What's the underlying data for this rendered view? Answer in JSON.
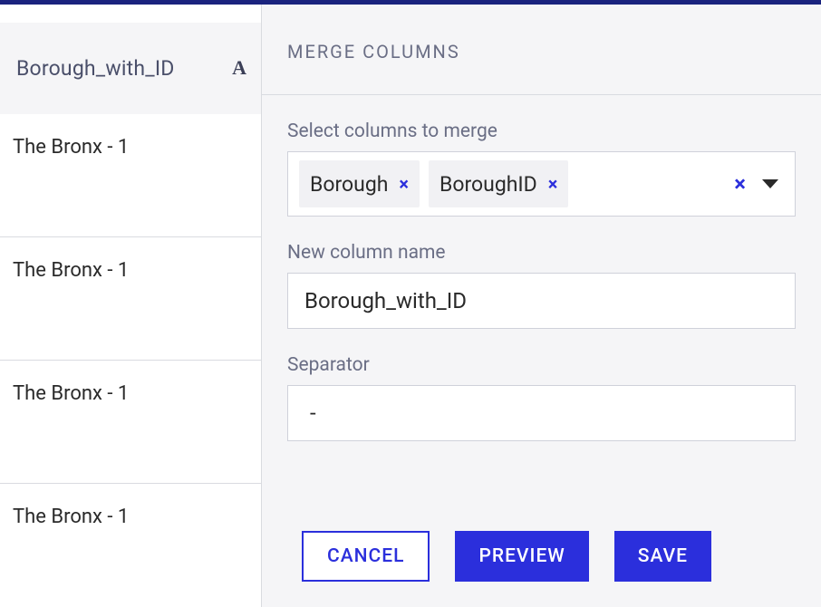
{
  "left_column": {
    "header_label": "Borough_with_ID",
    "rows": [
      "The Bronx - 1",
      "The Bronx - 1",
      "The Bronx - 1",
      "The Bronx - 1"
    ]
  },
  "panel": {
    "title": "MERGE COLUMNS",
    "select_columns_label": "Select columns to merge",
    "selected_columns": [
      "Borough",
      "BoroughID"
    ],
    "new_column_label": "New column name",
    "new_column_value": "Borough_with_ID",
    "separator_label": "Separator",
    "separator_value": " - ",
    "buttons": {
      "cancel": "CANCEL",
      "preview": "PREVIEW",
      "save": "SAVE"
    }
  }
}
